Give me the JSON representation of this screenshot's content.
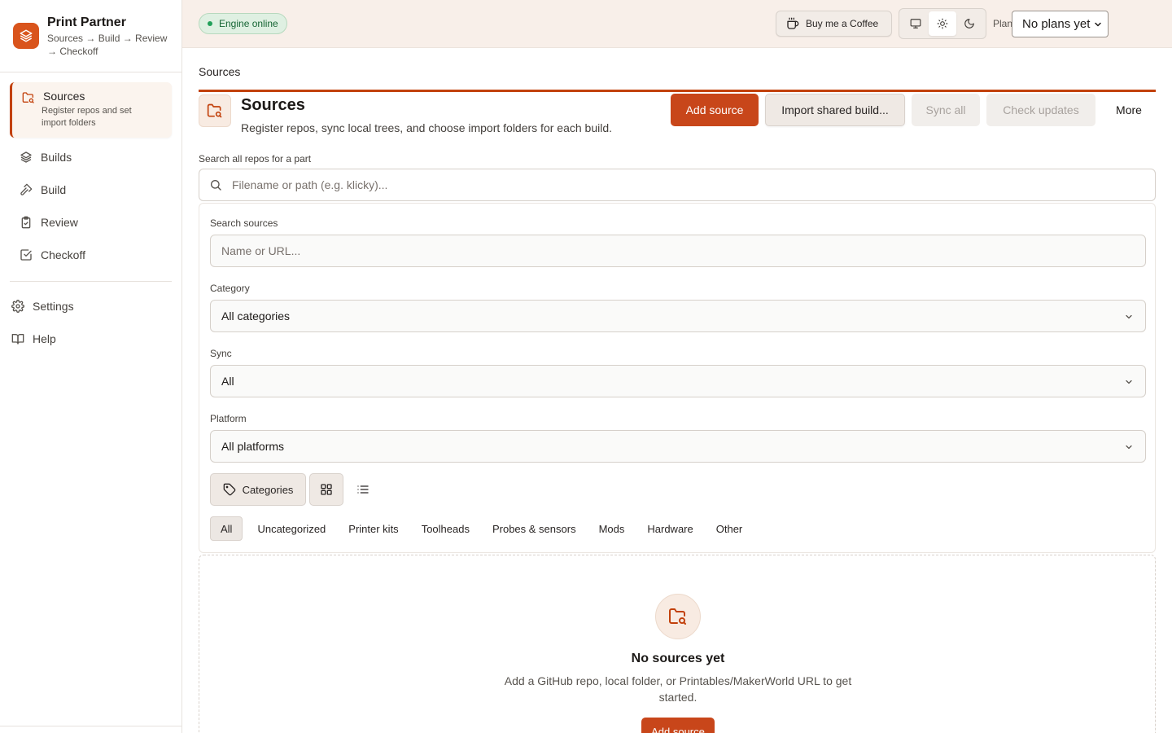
{
  "app": {
    "title": "Print Partner",
    "subtitle": "Sources → Build → Review → Checkoff"
  },
  "sidebar": {
    "items": [
      {
        "label": "Sources",
        "desc": "Register repos and set import folders",
        "icon": "folder-search-icon",
        "active": true
      },
      {
        "label": "Builds",
        "icon": "layers-icon"
      },
      {
        "label": "Build",
        "icon": "hammer-icon"
      },
      {
        "label": "Review",
        "icon": "clipboard-icon"
      },
      {
        "label": "Checkoff",
        "icon": "checkbox-icon"
      }
    ],
    "secondary": [
      {
        "label": "Settings",
        "icon": "gear-icon"
      },
      {
        "label": "Help",
        "icon": "book-icon"
      }
    ]
  },
  "header": {
    "status": "Engine online",
    "coffee_label": "Buy me a Coffee",
    "theme_modes": [
      "system",
      "light",
      "dark"
    ],
    "active_theme": "light",
    "plan_label": "Plan",
    "plan_value": "No plans yet"
  },
  "page": {
    "breadcrumb": "Sources",
    "title": "Sources",
    "subtitle": "Register repos, sync local trees, and choose import folders for each build.",
    "actions": {
      "add": "Add source",
      "import": "Import shared build...",
      "sync": "Sync all",
      "check": "Check updates",
      "more": "More"
    }
  },
  "search": {
    "label": "Search all repos for a part",
    "placeholder": "Filename or path (e.g. klicky)..."
  },
  "filters": {
    "sources_label": "Search sources",
    "sources_placeholder": "Name or URL...",
    "category_label": "Category",
    "category_value": "All categories",
    "sync_label": "Sync",
    "sync_value": "All",
    "platform_label": "Platform",
    "platform_value": "All platforms",
    "categories_button": "Categories",
    "chips": [
      "All",
      "Uncategorized",
      "Printer kits",
      "Toolheads",
      "Probes & sensors",
      "Mods",
      "Hardware",
      "Other"
    ],
    "active_chip": "All"
  },
  "empty": {
    "title": "No sources yet",
    "text": "Add a GitHub repo, local folder, or Printables/MakerWorld URL to get started.",
    "button": "Add source"
  },
  "colors": {
    "accent": "#c8461a",
    "header_bg": "#f8efe9",
    "status_bg": "#dff0e2"
  }
}
